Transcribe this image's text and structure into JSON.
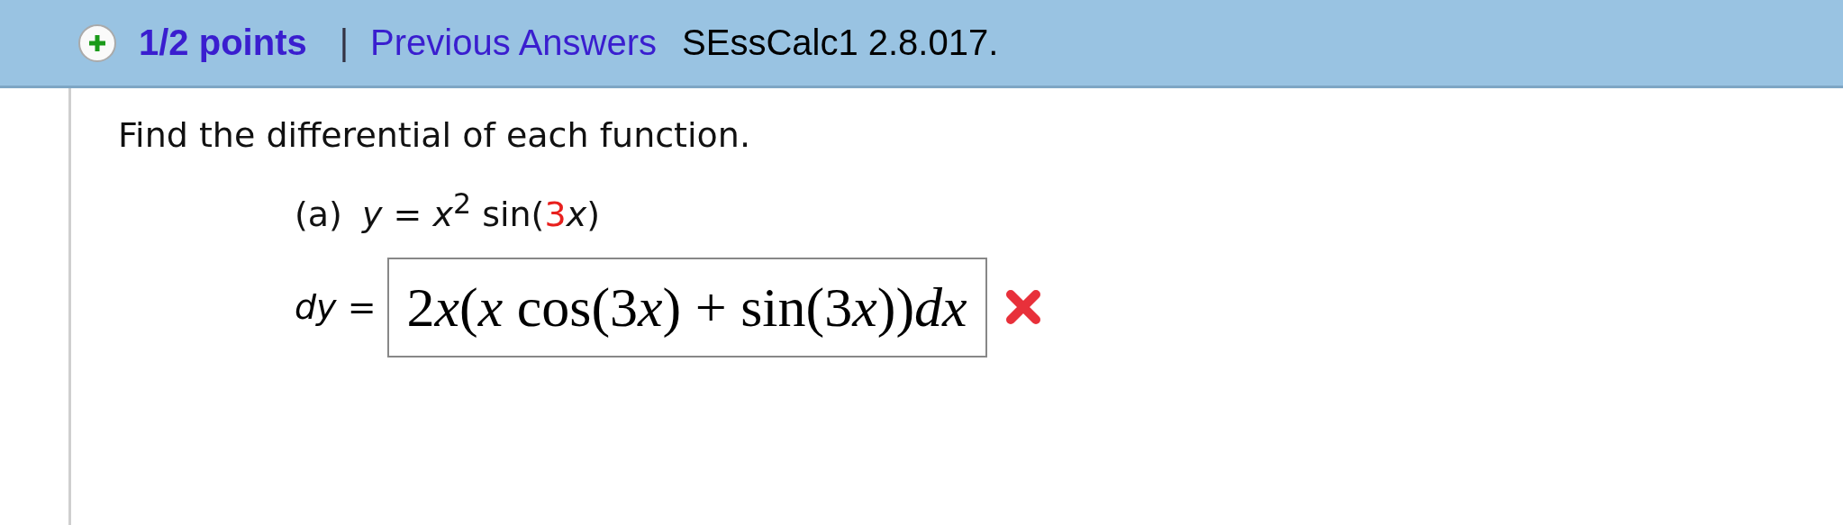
{
  "header": {
    "points": "1/2 points",
    "separator": "|",
    "link": "Previous Answers",
    "problem_code": "SEssCalc1 2.8.017."
  },
  "question": {
    "prompt": "Find the differential of each function.",
    "parts": [
      {
        "label": "(a)",
        "function": [
          {
            "text": "*y* = *x*$^{2}$ sin(",
            "highlight": false
          },
          {
            "text": "3",
            "highlight": true
          },
          {
            "text": "*x*)",
            "highlight": false
          }
        ],
        "answer_label": "*dy* =",
        "answer": [
          {
            "text": "2",
            "italic": false
          },
          {
            "text": "x",
            "italic": true
          },
          {
            "text": "(",
            "italic": false
          },
          {
            "text": "x",
            "italic": true
          },
          {
            "text": " cos(3",
            "italic": false
          },
          {
            "text": "x",
            "italic": true
          },
          {
            "text": ") + sin(3",
            "italic": false
          },
          {
            "text": "x",
            "italic": true
          },
          {
            "text": "))",
            "italic": false
          },
          {
            "text": "dx",
            "italic": true
          }
        ],
        "correct": false
      }
    ]
  }
}
